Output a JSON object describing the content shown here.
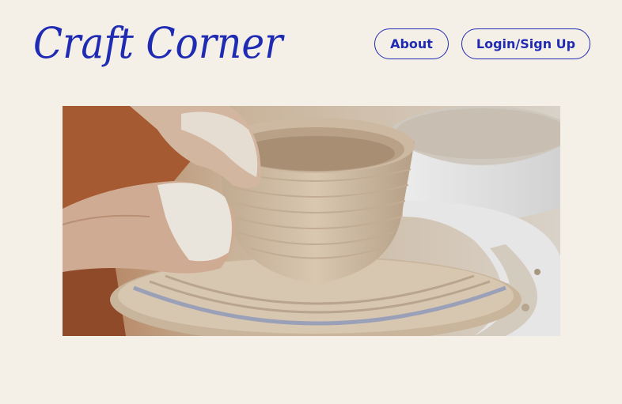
{
  "header": {
    "logo_text": "Craft Corner",
    "nav": {
      "about_label": "About",
      "login_label": "Login/Sign Up"
    }
  },
  "hero": {
    "image_subject": "pottery-wheel-bowl"
  },
  "colors": {
    "background": "#f5f0e7",
    "accent": "#1f2bb3"
  }
}
